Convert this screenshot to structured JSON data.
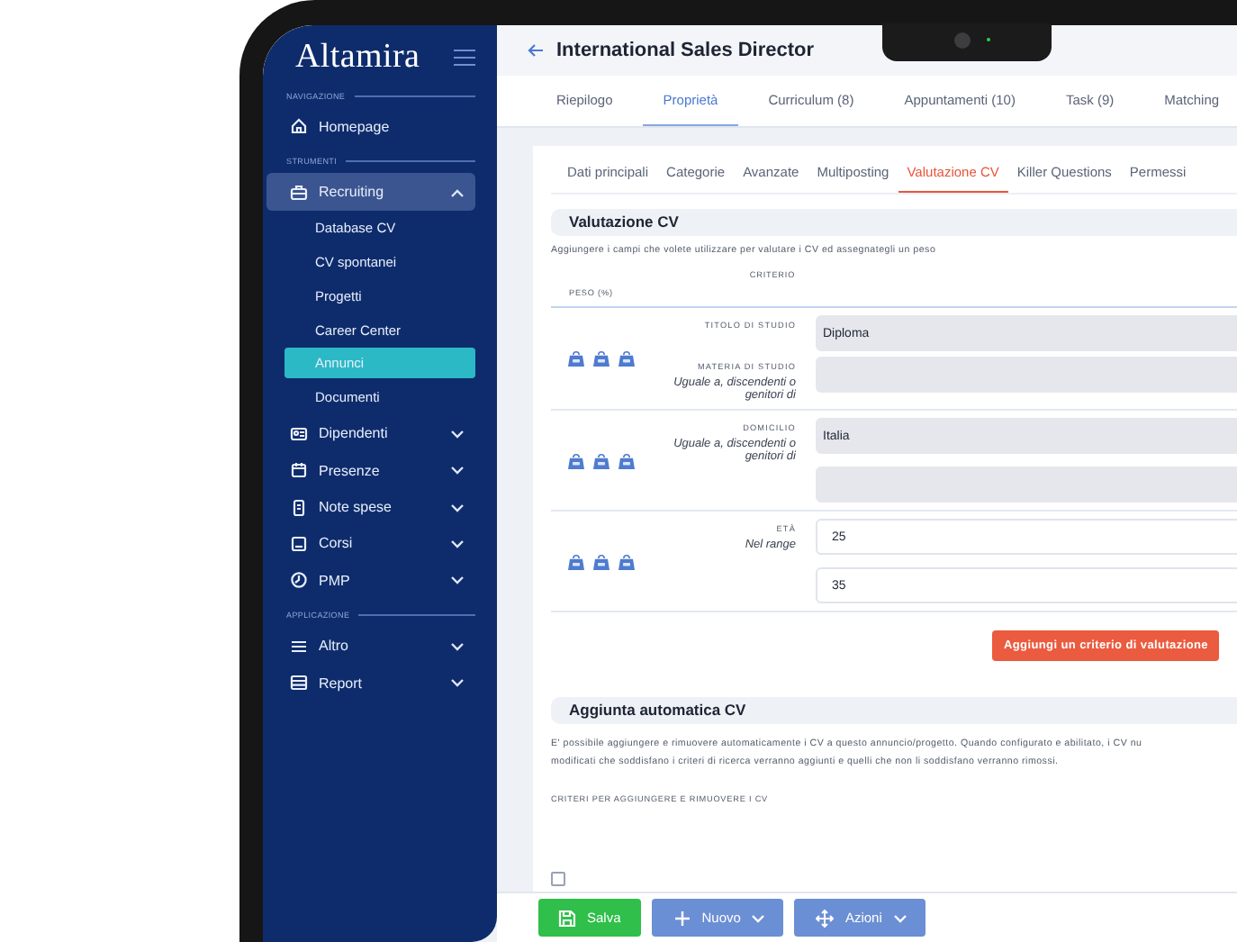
{
  "sidebar": {
    "logo": "Altamira",
    "groups": [
      {
        "heading": "NAVIGAZIONE",
        "items": [
          {
            "label": "Homepage"
          }
        ]
      },
      {
        "heading": "STRUMENTI",
        "items": [
          {
            "label": "Recruiting",
            "expanded": true,
            "children": [
              {
                "label": "Database CV",
                "selected": false
              },
              {
                "label": "CV spontanei",
                "selected": false
              },
              {
                "label": "Progetti",
                "selected": false
              },
              {
                "label": "Career Center",
                "selected": false
              },
              {
                "label": "Annunci",
                "selected": true
              },
              {
                "label": "Documenti",
                "selected": false
              }
            ]
          },
          {
            "label": "Dipendenti",
            "expanded": false
          },
          {
            "label": "Presenze",
            "expanded": false
          },
          {
            "label": "Note spese",
            "expanded": false
          },
          {
            "label": "Corsi",
            "expanded": false
          },
          {
            "label": "PMP",
            "expanded": false
          }
        ]
      },
      {
        "heading": "APPLICAZIONE",
        "items": [
          {
            "label": "Altro",
            "expanded": false
          },
          {
            "label": "Report",
            "expanded": false
          }
        ]
      }
    ]
  },
  "header": {
    "title": "International Sales Director"
  },
  "tabs": [
    {
      "label": "Riepilogo",
      "selected": false
    },
    {
      "label": "Proprietà",
      "selected": true
    },
    {
      "label": "Curriculum (8)",
      "selected": false
    },
    {
      "label": "Appuntamenti (10)",
      "selected": false
    },
    {
      "label": "Task (9)",
      "selected": false
    },
    {
      "label": "Matching",
      "selected": false
    }
  ],
  "subtabs": [
    {
      "label": "Dati principali",
      "selected": false
    },
    {
      "label": "Categorie",
      "selected": false
    },
    {
      "label": "Avanzate",
      "selected": false
    },
    {
      "label": "Multiposting",
      "selected": false
    },
    {
      "label": "Valutazione CV",
      "selected": true
    },
    {
      "label": "Killer Questions",
      "selected": false
    },
    {
      "label": "Permessi",
      "selected": false
    }
  ],
  "evaluation": {
    "title": "Valutazione CV",
    "description": "Aggiungere i campi che volete utilizzare per valutare i CV ed assegnategli un peso",
    "columns": [
      "PESO (%)",
      "CRITERIO"
    ],
    "criteria": [
      {
        "fields": [
          {
            "label": "TITOLO DI STUDIO",
            "inputs": [
              {
                "value": "Diploma",
                "disabled": true
              }
            ]
          },
          {
            "label": "MATERIA DI STUDIO",
            "qualifier": "Uguale a, discendenti o genitori di",
            "inputs": [
              {
                "disabled": true
              }
            ]
          }
        ]
      },
      {
        "fields": [
          {
            "label": "DOMICILIO",
            "qualifier": "Uguale a, discendenti o genitori di",
            "inputs": [
              {
                "value": "Italia",
                "disabled": true
              },
              {
                "disabled": true
              }
            ]
          }
        ]
      },
      {
        "fields": [
          {
            "label": "ETÀ",
            "qualifier": "Nel range",
            "inputs": [
              {
                "value": "25",
                "disabled": false
              },
              {
                "value": "35",
                "disabled": false
              }
            ]
          }
        ]
      }
    ],
    "add_button": "Aggiungi un criterio di valutazione"
  },
  "auto_add": {
    "title": "Aggiunta automatica CV",
    "description_lines": [
      "E' possibile aggiungere e rimuovere automaticamente i CV a questo annuncio/progetto. Quando configurato e abilitato, i CV nu",
      "modificati che soddisfano i criteri di ricerca verranno aggiunti e quelli che non li soddisfano verranno rimossi."
    ],
    "criteria_label": "CRITERI PER AGGIUNGERE E RIMUOVERE I CV",
    "enabled": {
      "checked": false
    }
  },
  "toolbar": [
    {
      "kind": "save",
      "label": "Salva"
    },
    {
      "kind": "new",
      "label": "Nuovo"
    },
    {
      "kind": "actions",
      "label": "Azioni"
    }
  ]
}
